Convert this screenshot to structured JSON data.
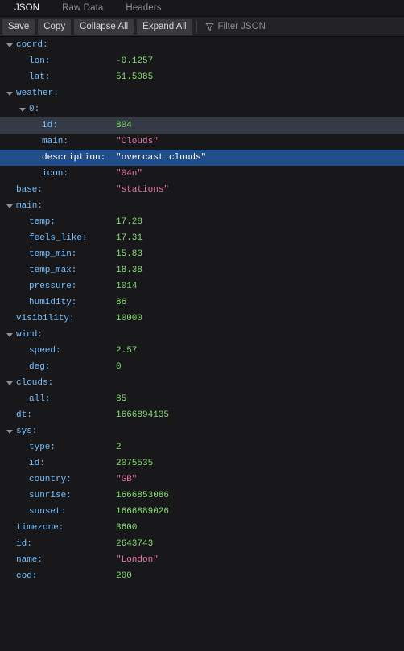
{
  "tabs": [
    {
      "label": "JSON",
      "active": true
    },
    {
      "label": "Raw Data",
      "active": false
    },
    {
      "label": "Headers",
      "active": false
    }
  ],
  "toolbar": {
    "save_label": "Save",
    "copy_label": "Copy",
    "collapse_all_label": "Collapse All",
    "expand_all_label": "Expand All",
    "filter_placeholder": "Filter JSON",
    "filter_value": ""
  },
  "colors": {
    "background": "#18181a",
    "toolbar_bg": "#232327",
    "key": "#75bfff",
    "number": "#86de74",
    "string": "#e675a8",
    "row_hover": "#353a47",
    "row_selected": "#204e8a",
    "tab_active_text": "#f0f0f2",
    "tab_text": "#8d8d92"
  },
  "rows": [
    {
      "key": "coord:",
      "value": "",
      "type": "object",
      "depth": 0,
      "expanded": true,
      "state": "normal"
    },
    {
      "key": "lon:",
      "value": "-0.1257",
      "type": "number",
      "depth": 1,
      "expanded": false,
      "state": "normal"
    },
    {
      "key": "lat:",
      "value": "51.5085",
      "type": "number",
      "depth": 1,
      "expanded": false,
      "state": "normal"
    },
    {
      "key": "weather:",
      "value": "",
      "type": "object",
      "depth": 0,
      "expanded": true,
      "state": "normal"
    },
    {
      "key": "0:",
      "value": "",
      "type": "object",
      "depth": 1,
      "expanded": true,
      "state": "normal"
    },
    {
      "key": "id:",
      "value": "804",
      "type": "number",
      "depth": 2,
      "expanded": false,
      "state": "hover"
    },
    {
      "key": "main:",
      "value": "\"Clouds\"",
      "type": "string",
      "depth": 2,
      "expanded": false,
      "state": "normal"
    },
    {
      "key": "description:",
      "value": "\"overcast clouds\"",
      "type": "string",
      "depth": 2,
      "expanded": false,
      "state": "selected"
    },
    {
      "key": "icon:",
      "value": "\"04n\"",
      "type": "string",
      "depth": 2,
      "expanded": false,
      "state": "normal"
    },
    {
      "key": "base:",
      "value": "\"stations\"",
      "type": "string",
      "depth": 0,
      "expanded": false,
      "state": "normal"
    },
    {
      "key": "main:",
      "value": "",
      "type": "object",
      "depth": 0,
      "expanded": true,
      "state": "normal"
    },
    {
      "key": "temp:",
      "value": "17.28",
      "type": "number",
      "depth": 1,
      "expanded": false,
      "state": "normal"
    },
    {
      "key": "feels_like:",
      "value": "17.31",
      "type": "number",
      "depth": 1,
      "expanded": false,
      "state": "normal"
    },
    {
      "key": "temp_min:",
      "value": "15.83",
      "type": "number",
      "depth": 1,
      "expanded": false,
      "state": "normal"
    },
    {
      "key": "temp_max:",
      "value": "18.38",
      "type": "number",
      "depth": 1,
      "expanded": false,
      "state": "normal"
    },
    {
      "key": "pressure:",
      "value": "1014",
      "type": "number",
      "depth": 1,
      "expanded": false,
      "state": "normal"
    },
    {
      "key": "humidity:",
      "value": "86",
      "type": "number",
      "depth": 1,
      "expanded": false,
      "state": "normal"
    },
    {
      "key": "visibility:",
      "value": "10000",
      "type": "number",
      "depth": 0,
      "expanded": false,
      "state": "normal"
    },
    {
      "key": "wind:",
      "value": "",
      "type": "object",
      "depth": 0,
      "expanded": true,
      "state": "normal"
    },
    {
      "key": "speed:",
      "value": "2.57",
      "type": "number",
      "depth": 1,
      "expanded": false,
      "state": "normal"
    },
    {
      "key": "deg:",
      "value": "0",
      "type": "number",
      "depth": 1,
      "expanded": false,
      "state": "normal"
    },
    {
      "key": "clouds:",
      "value": "",
      "type": "object",
      "depth": 0,
      "expanded": true,
      "state": "normal"
    },
    {
      "key": "all:",
      "value": "85",
      "type": "number",
      "depth": 1,
      "expanded": false,
      "state": "normal"
    },
    {
      "key": "dt:",
      "value": "1666894135",
      "type": "number",
      "depth": 0,
      "expanded": false,
      "state": "normal"
    },
    {
      "key": "sys:",
      "value": "",
      "type": "object",
      "depth": 0,
      "expanded": true,
      "state": "normal"
    },
    {
      "key": "type:",
      "value": "2",
      "type": "number",
      "depth": 1,
      "expanded": false,
      "state": "normal"
    },
    {
      "key": "id:",
      "value": "2075535",
      "type": "number",
      "depth": 1,
      "expanded": false,
      "state": "normal"
    },
    {
      "key": "country:",
      "value": "\"GB\"",
      "type": "string",
      "depth": 1,
      "expanded": false,
      "state": "normal"
    },
    {
      "key": "sunrise:",
      "value": "1666853086",
      "type": "number",
      "depth": 1,
      "expanded": false,
      "state": "normal"
    },
    {
      "key": "sunset:",
      "value": "1666889026",
      "type": "number",
      "depth": 1,
      "expanded": false,
      "state": "normal"
    },
    {
      "key": "timezone:",
      "value": "3600",
      "type": "number",
      "depth": 0,
      "expanded": false,
      "state": "normal"
    },
    {
      "key": "id:",
      "value": "2643743",
      "type": "number",
      "depth": 0,
      "expanded": false,
      "state": "normal"
    },
    {
      "key": "name:",
      "value": "\"London\"",
      "type": "string",
      "depth": 0,
      "expanded": false,
      "state": "normal"
    },
    {
      "key": "cod:",
      "value": "200",
      "type": "number",
      "depth": 0,
      "expanded": false,
      "state": "normal"
    }
  ]
}
